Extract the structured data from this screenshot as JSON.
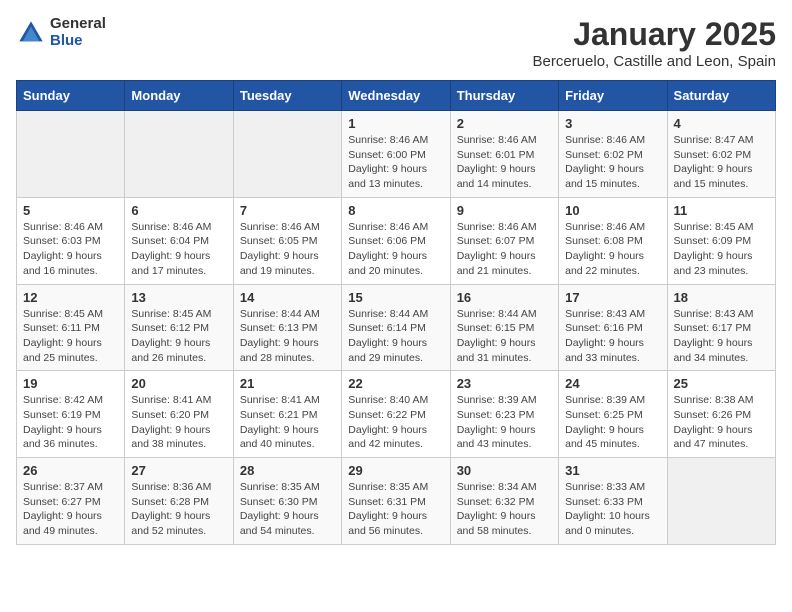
{
  "logo": {
    "general": "General",
    "blue": "Blue"
  },
  "title": "January 2025",
  "subtitle": "Berceruelo, Castille and Leon, Spain",
  "weekdays": [
    "Sunday",
    "Monday",
    "Tuesday",
    "Wednesday",
    "Thursday",
    "Friday",
    "Saturday"
  ],
  "weeks": [
    [
      {
        "day": "",
        "detail": ""
      },
      {
        "day": "",
        "detail": ""
      },
      {
        "day": "",
        "detail": ""
      },
      {
        "day": "1",
        "detail": "Sunrise: 8:46 AM\nSunset: 6:00 PM\nDaylight: 9 hours\nand 13 minutes."
      },
      {
        "day": "2",
        "detail": "Sunrise: 8:46 AM\nSunset: 6:01 PM\nDaylight: 9 hours\nand 14 minutes."
      },
      {
        "day": "3",
        "detail": "Sunrise: 8:46 AM\nSunset: 6:02 PM\nDaylight: 9 hours\nand 15 minutes."
      },
      {
        "day": "4",
        "detail": "Sunrise: 8:47 AM\nSunset: 6:02 PM\nDaylight: 9 hours\nand 15 minutes."
      }
    ],
    [
      {
        "day": "5",
        "detail": "Sunrise: 8:46 AM\nSunset: 6:03 PM\nDaylight: 9 hours\nand 16 minutes."
      },
      {
        "day": "6",
        "detail": "Sunrise: 8:46 AM\nSunset: 6:04 PM\nDaylight: 9 hours\nand 17 minutes."
      },
      {
        "day": "7",
        "detail": "Sunrise: 8:46 AM\nSunset: 6:05 PM\nDaylight: 9 hours\nand 19 minutes."
      },
      {
        "day": "8",
        "detail": "Sunrise: 8:46 AM\nSunset: 6:06 PM\nDaylight: 9 hours\nand 20 minutes."
      },
      {
        "day": "9",
        "detail": "Sunrise: 8:46 AM\nSunset: 6:07 PM\nDaylight: 9 hours\nand 21 minutes."
      },
      {
        "day": "10",
        "detail": "Sunrise: 8:46 AM\nSunset: 6:08 PM\nDaylight: 9 hours\nand 22 minutes."
      },
      {
        "day": "11",
        "detail": "Sunrise: 8:45 AM\nSunset: 6:09 PM\nDaylight: 9 hours\nand 23 minutes."
      }
    ],
    [
      {
        "day": "12",
        "detail": "Sunrise: 8:45 AM\nSunset: 6:11 PM\nDaylight: 9 hours\nand 25 minutes."
      },
      {
        "day": "13",
        "detail": "Sunrise: 8:45 AM\nSunset: 6:12 PM\nDaylight: 9 hours\nand 26 minutes."
      },
      {
        "day": "14",
        "detail": "Sunrise: 8:44 AM\nSunset: 6:13 PM\nDaylight: 9 hours\nand 28 minutes."
      },
      {
        "day": "15",
        "detail": "Sunrise: 8:44 AM\nSunset: 6:14 PM\nDaylight: 9 hours\nand 29 minutes."
      },
      {
        "day": "16",
        "detail": "Sunrise: 8:44 AM\nSunset: 6:15 PM\nDaylight: 9 hours\nand 31 minutes."
      },
      {
        "day": "17",
        "detail": "Sunrise: 8:43 AM\nSunset: 6:16 PM\nDaylight: 9 hours\nand 33 minutes."
      },
      {
        "day": "18",
        "detail": "Sunrise: 8:43 AM\nSunset: 6:17 PM\nDaylight: 9 hours\nand 34 minutes."
      }
    ],
    [
      {
        "day": "19",
        "detail": "Sunrise: 8:42 AM\nSunset: 6:19 PM\nDaylight: 9 hours\nand 36 minutes."
      },
      {
        "day": "20",
        "detail": "Sunrise: 8:41 AM\nSunset: 6:20 PM\nDaylight: 9 hours\nand 38 minutes."
      },
      {
        "day": "21",
        "detail": "Sunrise: 8:41 AM\nSunset: 6:21 PM\nDaylight: 9 hours\nand 40 minutes."
      },
      {
        "day": "22",
        "detail": "Sunrise: 8:40 AM\nSunset: 6:22 PM\nDaylight: 9 hours\nand 42 minutes."
      },
      {
        "day": "23",
        "detail": "Sunrise: 8:39 AM\nSunset: 6:23 PM\nDaylight: 9 hours\nand 43 minutes."
      },
      {
        "day": "24",
        "detail": "Sunrise: 8:39 AM\nSunset: 6:25 PM\nDaylight: 9 hours\nand 45 minutes."
      },
      {
        "day": "25",
        "detail": "Sunrise: 8:38 AM\nSunset: 6:26 PM\nDaylight: 9 hours\nand 47 minutes."
      }
    ],
    [
      {
        "day": "26",
        "detail": "Sunrise: 8:37 AM\nSunset: 6:27 PM\nDaylight: 9 hours\nand 49 minutes."
      },
      {
        "day": "27",
        "detail": "Sunrise: 8:36 AM\nSunset: 6:28 PM\nDaylight: 9 hours\nand 52 minutes."
      },
      {
        "day": "28",
        "detail": "Sunrise: 8:35 AM\nSunset: 6:30 PM\nDaylight: 9 hours\nand 54 minutes."
      },
      {
        "day": "29",
        "detail": "Sunrise: 8:35 AM\nSunset: 6:31 PM\nDaylight: 9 hours\nand 56 minutes."
      },
      {
        "day": "30",
        "detail": "Sunrise: 8:34 AM\nSunset: 6:32 PM\nDaylight: 9 hours\nand 58 minutes."
      },
      {
        "day": "31",
        "detail": "Sunrise: 8:33 AM\nSunset: 6:33 PM\nDaylight: 10 hours\nand 0 minutes."
      },
      {
        "day": "",
        "detail": ""
      }
    ]
  ]
}
